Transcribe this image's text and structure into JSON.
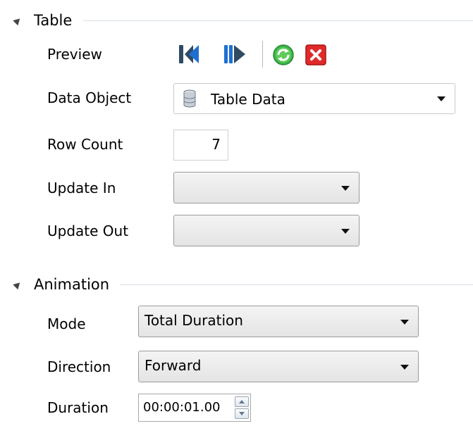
{
  "sections": {
    "table": {
      "title": "Table",
      "preview_label": "Preview",
      "data_object_label": "Data Object",
      "data_object_value": "Table Data",
      "row_count_label": "Row Count",
      "row_count_value": "7",
      "update_in_label": "Update In",
      "update_in_value": "",
      "update_out_label": "Update Out",
      "update_out_value": ""
    },
    "animation": {
      "title": "Animation",
      "mode_label": "Mode",
      "mode_value": "Total Duration",
      "direction_label": "Direction",
      "direction_value": "Forward",
      "duration_label": "Duration",
      "duration_value": "00:00:01.00"
    }
  },
  "icons": {
    "preview_first": "skip-to-start-icon",
    "preview_play": "play-forward-icon",
    "refresh": "refresh-icon",
    "close": "close-icon",
    "database": "database-icon"
  },
  "colors": {
    "icon_blue": "#1f6fd1",
    "icon_dark": "#2f4a63",
    "refresh_green": "#3bb54a",
    "close_red": "#e02a2a",
    "section_rule": "#d7dfe8"
  }
}
